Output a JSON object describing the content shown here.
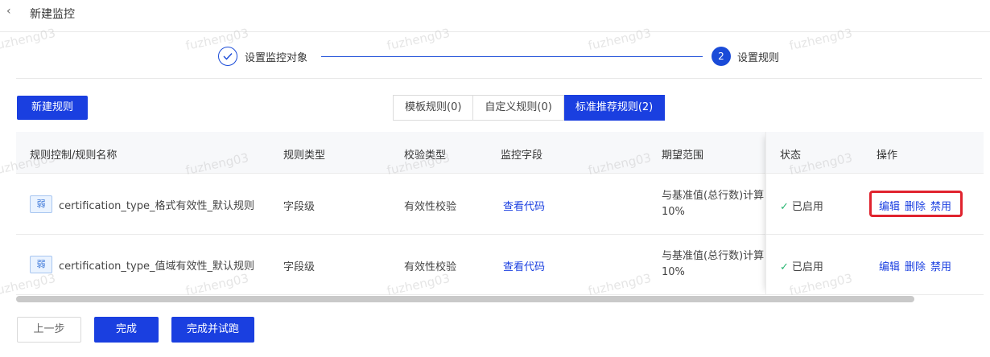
{
  "header": {
    "back_icon": "chevron-left-icon",
    "title": "新建监控"
  },
  "steps": [
    {
      "label": "设置监控对象",
      "state": "done"
    },
    {
      "label": "设置规则",
      "number": "2",
      "state": "active"
    }
  ],
  "toolbar": {
    "new_rule_label": "新建规则"
  },
  "tabs": [
    {
      "label": "模板规则(0)",
      "active": false
    },
    {
      "label": "自定义规则(0)",
      "active": false
    },
    {
      "label": "标准推荐规则(2)",
      "active": true
    }
  ],
  "table": {
    "columns": [
      "规则控制/规则名称",
      "规则类型",
      "校验类型",
      "监控字段",
      "期望范围",
      "状态",
      "操作"
    ],
    "rows": [
      {
        "tag": "弱",
        "name": "certification_type_格式有效性_默认规则",
        "rule_type": "字段级",
        "check_type": "有效性校验",
        "field_link": "查看代码",
        "expect_line1": "与基准值(总行数)计算",
        "expect_line2": "10%",
        "status": "已启用",
        "ops": {
          "edit": "编辑",
          "delete": "删除",
          "disable": "禁用"
        }
      },
      {
        "tag": "弱",
        "name": "certification_type_值域有效性_默认规则",
        "rule_type": "字段级",
        "check_type": "有效性校验",
        "field_link": "查看代码",
        "expect_line1": "与基准值(总行数)计算",
        "expect_line2": "10%",
        "status": "已启用",
        "ops": {
          "edit": "编辑",
          "delete": "删除",
          "disable": "禁用"
        }
      }
    ]
  },
  "footer": {
    "prev_label": "上一步",
    "done_label": "完成",
    "done_run_label": "完成并试跑"
  },
  "watermark": "fuzheng03",
  "colors": {
    "primary": "#1a3fe0",
    "success": "#2bb673",
    "highlight": "#e0232e"
  }
}
